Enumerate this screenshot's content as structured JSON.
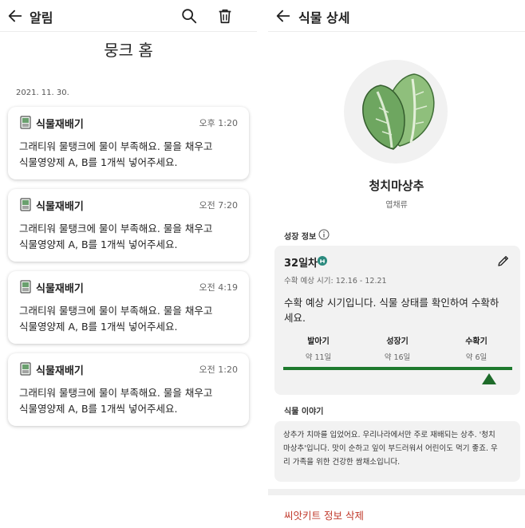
{
  "left": {
    "header": {
      "title": "알림",
      "back_icon": "arrow-left-icon",
      "search_icon": "search-icon",
      "delete_icon": "trash-icon"
    },
    "home_title": "뭉크 홈",
    "date": "2021. 11. 30.",
    "notifications": [
      {
        "sender": "식물재배기",
        "time": "오후 1:20",
        "line1": "그래티워 물탱크에 물이 부족해요. 물을 채우고",
        "line2": "식물영양제 A, B를 1개씩 넣어주세요."
      },
      {
        "sender": "식물재배기",
        "time": "오전 7:20",
        "line1": "그래티워 물탱크에 물이 부족해요. 물을 채우고",
        "line2": "식물영양제 A, B를 1개씩 넣어주세요."
      },
      {
        "sender": "식물재배기",
        "time": "오전 4:19",
        "line1": "그래티워 물탱크에 물이 부족해요. 물을 채우고",
        "line2": "식물영양제 A, B를 1개씩 넣어주세요."
      },
      {
        "sender": "식물재배기",
        "time": "오전 1:20",
        "line1": "그래티워 물탱크에 물이 부족해요. 물을 채우고",
        "line2": "식물영양제 A, B를 1개씩 넣어주세요."
      }
    ]
  },
  "right": {
    "header": {
      "title": "식물 상세",
      "back_icon": "arrow-left-icon"
    },
    "plant": {
      "name": "청치마상추",
      "type": "엽채류",
      "image_icon": "lettuce-illustration"
    },
    "growth": {
      "section_label": "성장 정보",
      "info_icon": "info-circle-icon",
      "day_label": "32일차",
      "badge_icon": "growth-badge-icon",
      "edit_icon": "pencil-icon",
      "harvest_window": "수확 예상 시기: 12.16 - 12.21",
      "desc_line1": "수확 예상 시기입니다. 식물 상태를 확인하여 수확하",
      "desc_line2": "세요.",
      "stages": [
        {
          "name": "발아기",
          "days": "약 11일"
        },
        {
          "name": "성장기",
          "days": "약 16일"
        },
        {
          "name": "수확기",
          "days": "약 6일"
        }
      ],
      "progress_fraction": 0.9,
      "accent_color": "#1e7a2e"
    },
    "story": {
      "section_label": "식물 이야기",
      "line1": "상추가 치마를 입었어요. 우리나라에서만 주로 재배되는 상추. '청치",
      "line2": "마상추'입니다. 맛이 순하고 잎이 부드러워서 어린이도 먹기 좋죠. 우",
      "line3": "리 가족을 위한 건강한 쌈채소입니다."
    },
    "delete_label": "씨앗키트 정보 삭제",
    "delete_color": "#c0392b"
  }
}
